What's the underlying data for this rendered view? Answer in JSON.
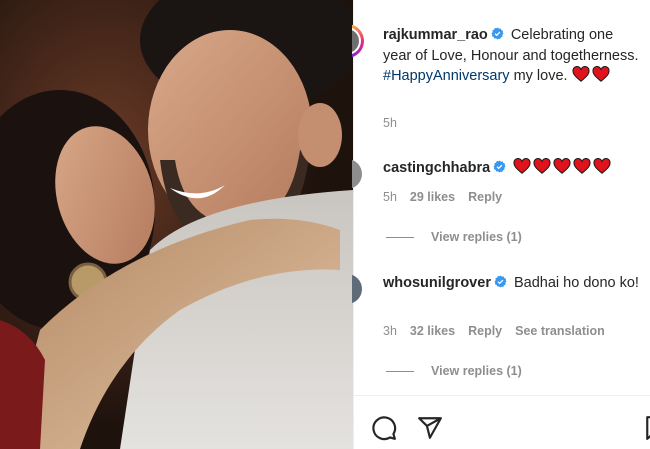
{
  "post": {
    "caption": {
      "username": "rajkummar_rao",
      "text_before_tag": "Celebrating one year of Love, Honour and togetherness.",
      "hashtag": "#HappyAnniversary",
      "text_after_tag": "my love.",
      "heart_count": 2,
      "time": "5h"
    }
  },
  "comments": [
    {
      "username": "castingchhabra",
      "text": "",
      "heart_count": 5,
      "time": "5h",
      "likes": "29 likes",
      "reply_label": "Reply",
      "view_replies": "View replies (1)"
    },
    {
      "username": "whosunilgrover",
      "text": "Badhai ho dono ko!",
      "time": "3h",
      "likes": "32 likes",
      "reply_label": "Reply",
      "see_translation": "See translation",
      "view_replies": "View replies (1)"
    }
  ],
  "icons": {
    "verified": "verified-badge-icon",
    "heart": "red-heart-icon",
    "comment": "comment-icon",
    "share": "share-icon",
    "save": "bookmark-icon"
  },
  "colors": {
    "verified_blue": "#3897f0",
    "heart_red": "#e0121b",
    "hashtag_blue": "#00376b",
    "meta_gray": "#8e8e8e"
  }
}
